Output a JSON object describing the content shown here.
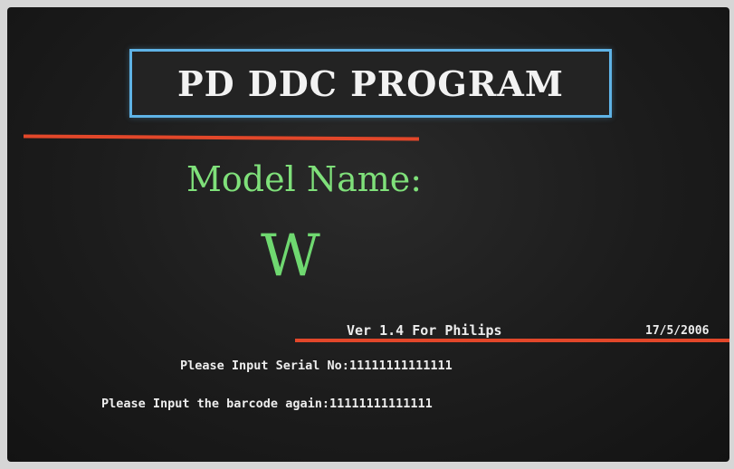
{
  "title": "PD DDC PROGRAM",
  "model": {
    "label": "Model Name:",
    "value": "W"
  },
  "version": "Ver 1.4 For Philips",
  "date": "17/5/2006",
  "prompts": {
    "serial": {
      "label": "Please Input Serial No:",
      "value": "11111111111111"
    },
    "barcode": {
      "label": "Please Input the barcode again:",
      "value": "11111111111111"
    }
  },
  "colors": {
    "title_border": "#5fb3e6",
    "rule": "#e2472a",
    "model_text": "#7fe07a",
    "text": "#ececec",
    "background": "#1c1c1c"
  }
}
